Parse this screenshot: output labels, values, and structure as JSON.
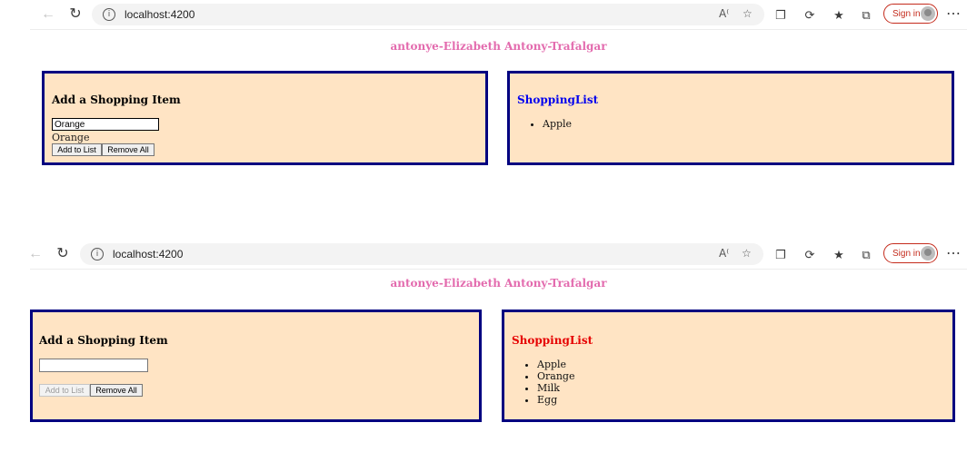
{
  "screens": [
    {
      "browser": {
        "url": "localhost:4200",
        "signin_label": "Sign in"
      },
      "page_title": "antonye-Elizabeth Antony-Trafalgar",
      "add_panel": {
        "heading": "Add a Shopping Item",
        "input_value": "Orange",
        "echo_text": "Orange",
        "add_button": "Add to List",
        "remove_button": "Remove All",
        "add_disabled": false
      },
      "list_panel": {
        "heading": "ShoppingList",
        "heading_color": "#0000ee",
        "items": [
          "Apple"
        ]
      }
    },
    {
      "browser": {
        "url": "localhost:4200",
        "signin_label": "Sign in"
      },
      "page_title": "antonye-Elizabeth Antony-Trafalgar",
      "add_panel": {
        "heading": "Add a Shopping Item",
        "input_value": "",
        "echo_text": "",
        "add_button": "Add to List",
        "remove_button": "Remove All",
        "add_disabled": true
      },
      "list_panel": {
        "heading": "ShoppingList",
        "heading_color": "#e60000",
        "items": [
          "Apple",
          "Orange",
          "Milk",
          "Egg"
        ]
      }
    }
  ],
  "icons": {
    "back": "back-arrow-icon",
    "refresh": "refresh-icon",
    "info": "site-info-icon",
    "read_aloud": "read-aloud-icon",
    "favorite": "add-favorite-icon",
    "extensions": "extensions-icon",
    "copilot": "browser-essentials-icon",
    "favorites_bar": "favorites-icon",
    "collections": "collections-icon",
    "more": "more-options-icon"
  },
  "colors": {
    "panel_bg": "#ffe4c4",
    "panel_border": "#000080",
    "title_pink": "#e36bae",
    "signin_red": "#c42b1c"
  }
}
